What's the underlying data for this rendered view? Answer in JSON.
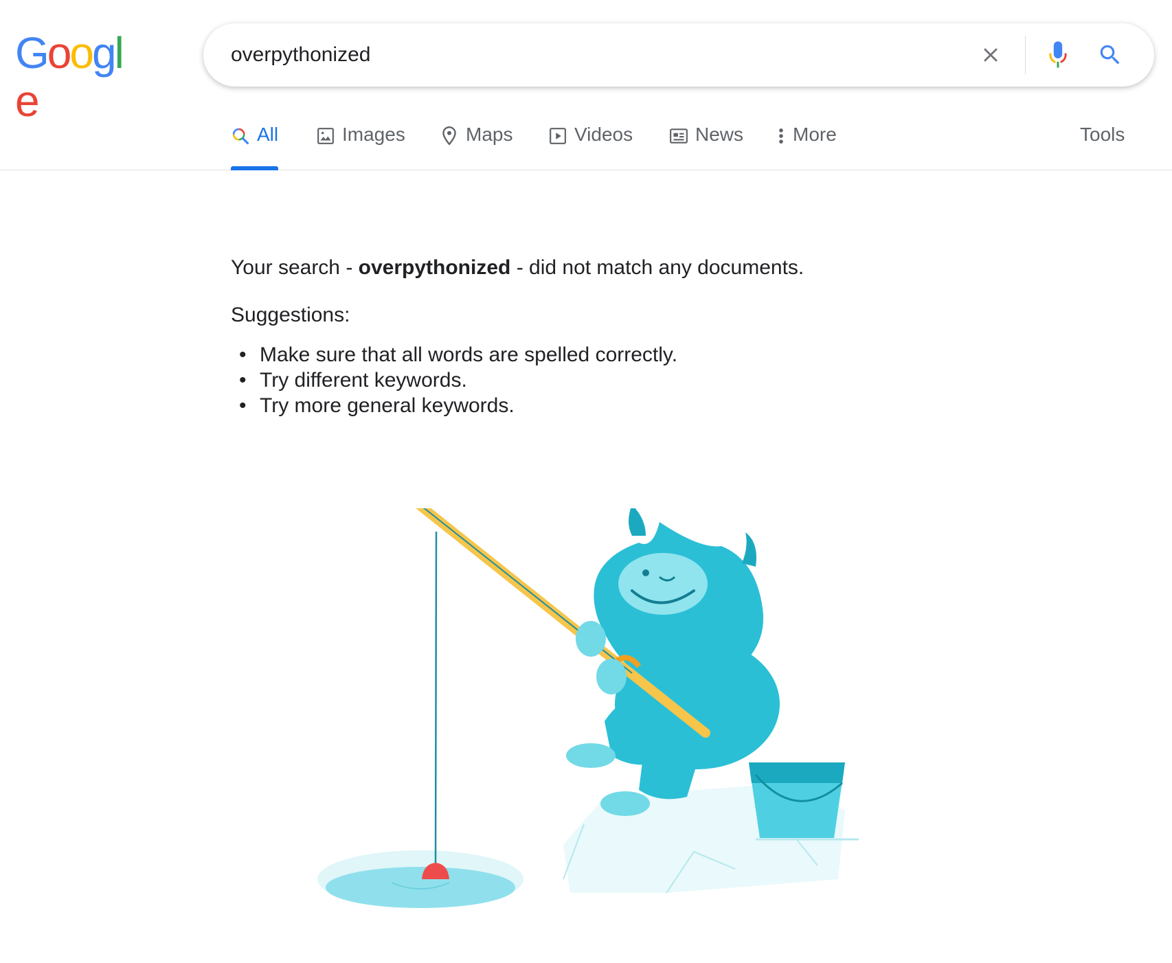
{
  "logo": {
    "letters": [
      {
        "char": "G",
        "color": "#4285F4"
      },
      {
        "char": "o",
        "color": "#EA4335"
      },
      {
        "char": "o",
        "color": "#FBBC05"
      },
      {
        "char": "g",
        "color": "#4285F4"
      },
      {
        "char": "l",
        "color": "#34A853"
      },
      {
        "char": "e",
        "color": "#EA4335"
      }
    ]
  },
  "search": {
    "query": "overpythonized",
    "clear_icon": "close-icon",
    "voice_icon": "microphone-icon",
    "submit_icon": "magnifier-icon"
  },
  "tabs": [
    {
      "label": "All",
      "icon": "search-icon",
      "active": true
    },
    {
      "label": "Images",
      "icon": "image-icon",
      "active": false
    },
    {
      "label": "Maps",
      "icon": "map-pin-icon",
      "active": false
    },
    {
      "label": "Videos",
      "icon": "play-icon",
      "active": false
    },
    {
      "label": "News",
      "icon": "newspaper-icon",
      "active": false
    },
    {
      "label": "More",
      "icon": "dots-vertical-icon",
      "active": false
    }
  ],
  "tools_label": "Tools",
  "result": {
    "prefix": "Your search - ",
    "query": "overpythonized",
    "suffix": " - did not match any documents.",
    "suggestions_title": "Suggestions:",
    "suggestions": [
      "Make sure that all words are spelled correctly.",
      "Try different keywords.",
      "Try more general keywords."
    ]
  },
  "colors": {
    "accent": "#1a73e8",
    "text": "#202124",
    "muted": "#5f6368",
    "yeti": "#2bbfd6",
    "rod": "#f6c54a",
    "bobber": "#ee4c4c"
  }
}
